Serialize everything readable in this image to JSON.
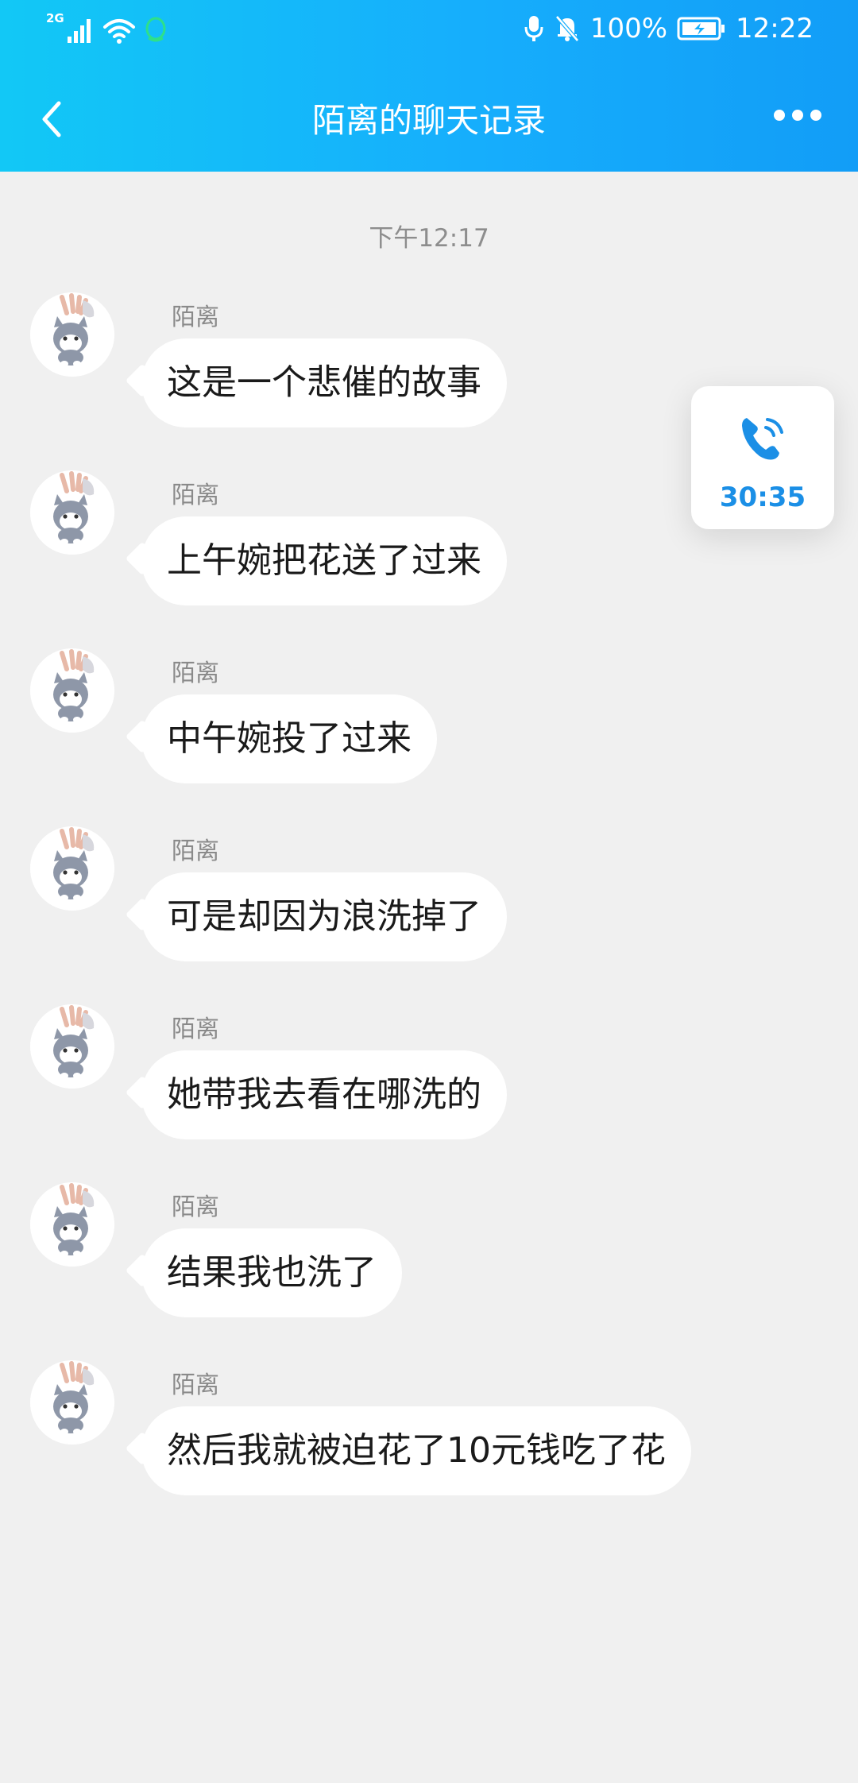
{
  "status_bar": {
    "signal_label": "2G",
    "battery_percent": "100%",
    "time": "12:22"
  },
  "header": {
    "title": "陌离的聊天记录"
  },
  "timestamp": "下午12:17",
  "messages": [
    {
      "sender": "陌离",
      "text": "这是一个悲催的故事"
    },
    {
      "sender": "陌离",
      "text": "上午婉把花送了过来"
    },
    {
      "sender": "陌离",
      "text": "中午婉投了过来"
    },
    {
      "sender": "陌离",
      "text": "可是却因为浪洗掉了"
    },
    {
      "sender": "陌离",
      "text": "她带我去看在哪洗的"
    },
    {
      "sender": "陌离",
      "text": "结果我也洗了"
    },
    {
      "sender": "陌离",
      "text": "然后我就被迫花了10元钱吃了花"
    }
  ],
  "call_widget": {
    "duration": "30:35",
    "icon": "phone-icon",
    "color": "#1b8fe6"
  },
  "colors": {
    "header_start": "#12c8f6",
    "header_end": "#129df7",
    "background": "#f0f0f0",
    "bubble": "#ffffff"
  }
}
